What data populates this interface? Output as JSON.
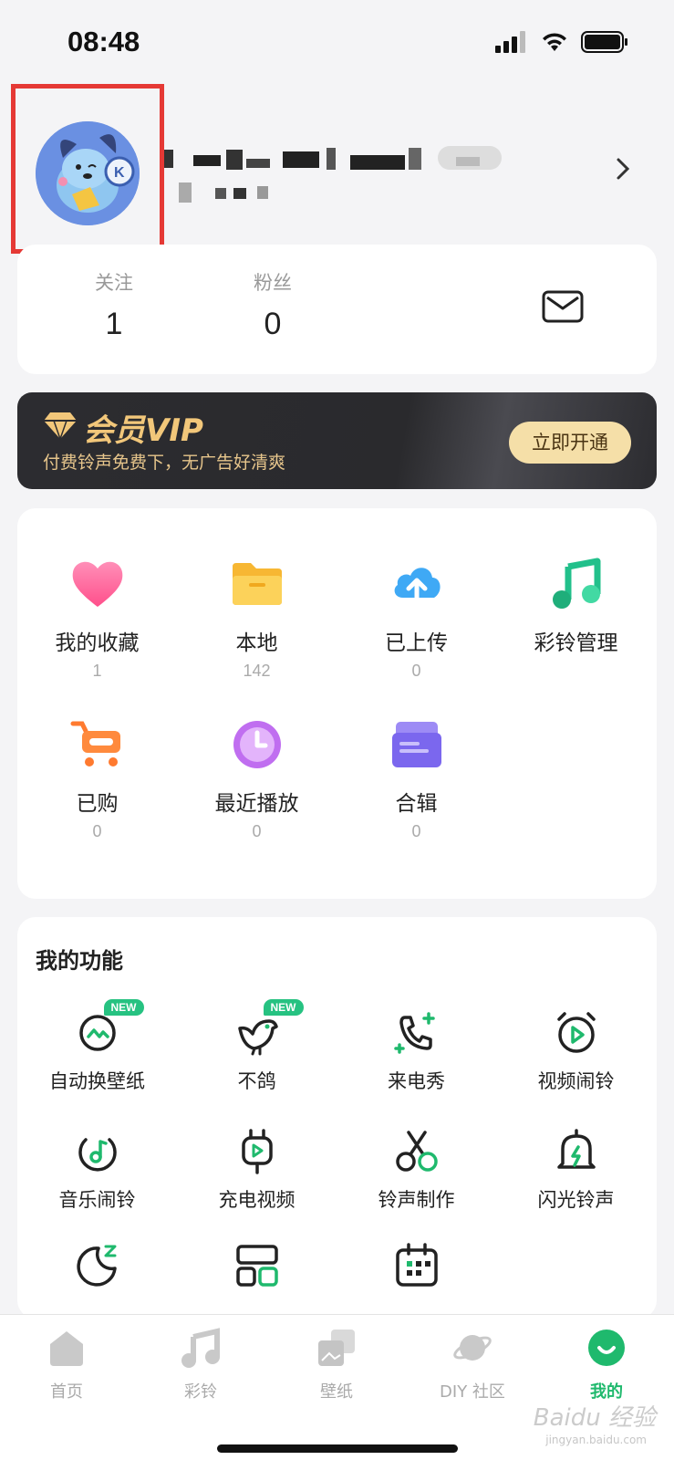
{
  "status": {
    "time": "08:48"
  },
  "profile": {},
  "stats": [
    {
      "label": "关注",
      "value": "1"
    },
    {
      "label": "粉丝",
      "value": "0"
    }
  ],
  "vip": {
    "title": "会员VIP",
    "subtitle": "付费铃声免费下，无广告好清爽",
    "button": "立即开通"
  },
  "library": [
    {
      "label": "我的收藏",
      "count": "1",
      "icon": "heart-icon"
    },
    {
      "label": "本地",
      "count": "142",
      "icon": "folder-icon"
    },
    {
      "label": "已上传",
      "count": "0",
      "icon": "cloud-upload-icon"
    },
    {
      "label": "彩铃管理",
      "count": "",
      "icon": "music-note-icon"
    },
    {
      "label": "已购",
      "count": "0",
      "icon": "cart-icon"
    },
    {
      "label": "最近播放",
      "count": "0",
      "icon": "clock-icon"
    },
    {
      "label": "合辑",
      "count": "0",
      "icon": "album-icon"
    }
  ],
  "functions": {
    "title": "我的功能",
    "items": [
      {
        "label": "自动换壁纸",
        "icon": "auto-wallpaper-icon",
        "badge": "NEW"
      },
      {
        "label": "不鸽",
        "icon": "bird-icon",
        "badge": "NEW"
      },
      {
        "label": "来电秀",
        "icon": "phone-icon"
      },
      {
        "label": "视频闹铃",
        "icon": "video-alarm-icon"
      },
      {
        "label": "音乐闹铃",
        "icon": "music-alarm-icon"
      },
      {
        "label": "充电视频",
        "icon": "charge-video-icon"
      },
      {
        "label": "铃声制作",
        "icon": "scissors-icon"
      },
      {
        "label": "闪光铃声",
        "icon": "flash-bell-icon"
      },
      {
        "label": "",
        "icon": "sleep-moon-icon"
      },
      {
        "label": "",
        "icon": "widget-icon"
      },
      {
        "label": "",
        "icon": "calendar-icon"
      }
    ]
  },
  "tabs": [
    {
      "label": "首页",
      "icon": "home-icon"
    },
    {
      "label": "彩铃",
      "icon": "music-icon"
    },
    {
      "label": "壁纸",
      "icon": "wallpaper-icon"
    },
    {
      "label": "DIY 社区",
      "icon": "planet-icon"
    },
    {
      "label": "我的",
      "icon": "me-icon",
      "active": true
    }
  ],
  "watermark": {
    "text": "Baidu 经验",
    "sub": "jingyan.baidu.com"
  },
  "colors": {
    "accent": "#1fb96d",
    "vip_gold": "#f2c77a",
    "highlight_red": "#e53935"
  }
}
